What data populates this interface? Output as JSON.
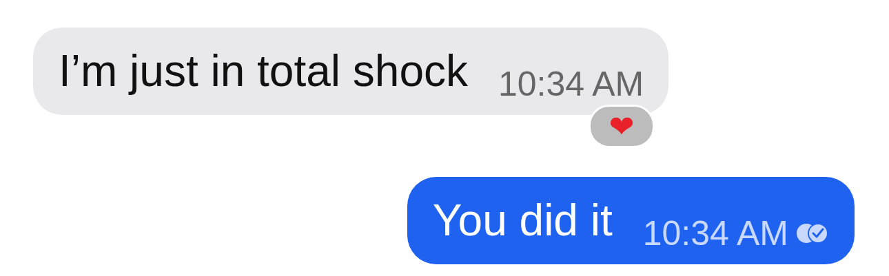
{
  "messages": [
    {
      "kind": "incoming",
      "text": "I’m just in total shock",
      "time": "10:34 AM",
      "reaction": "❤",
      "read": false
    },
    {
      "kind": "outgoing",
      "text": "You did it",
      "time": "10:34 AM",
      "read": true
    }
  ]
}
